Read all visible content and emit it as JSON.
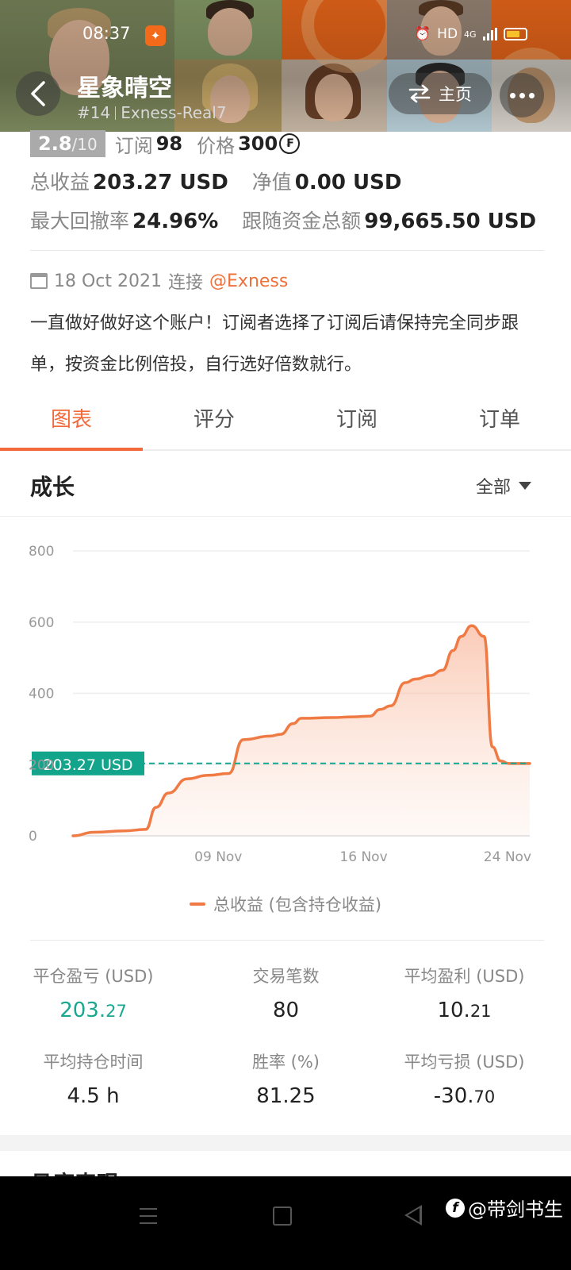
{
  "status_bar": {
    "time": "08:37",
    "indicators": "HD",
    "network": "4G"
  },
  "header": {
    "title": "星象晴空",
    "rank": "#14",
    "account": "Exness-Real7",
    "home_label": "主页"
  },
  "profile": {
    "rating": "2.8",
    "rating_max": "/10",
    "subscriptions_label": "订阅",
    "subscriptions": "98",
    "price_label": "价格",
    "price": "300",
    "price_icon": "₣",
    "total_profit_label": "总收益",
    "total_profit": "203.27 USD",
    "equity_label": "净值",
    "equity": "0.00 USD",
    "max_drawdown_label": "最大回撤率",
    "max_drawdown": "24.96%",
    "follow_funds_label": "跟随资金总额",
    "follow_funds": "99,665.50 USD",
    "connected_date": "18 Oct 2021",
    "connected_label": "连接",
    "broker": "@Exness",
    "description": "一直做好做好这个账户！订阅者选择了订阅后请保持完全同步跟单，按资金比例倍投，自行选好倍数就行。"
  },
  "tabs": [
    {
      "label": "图表",
      "active": true
    },
    {
      "label": "评分",
      "active": false
    },
    {
      "label": "订阅",
      "active": false
    },
    {
      "label": "订单",
      "active": false
    }
  ],
  "section": {
    "title": "成长",
    "filter": "全部"
  },
  "chart_data": {
    "type": "area",
    "y_ticks": [
      "800",
      "600",
      "400",
      "200",
      "0"
    ],
    "ylim": [
      0,
      800
    ],
    "x_ticks": [
      {
        "label": "09 Nov",
        "x": 9
      },
      {
        "label": "16 Nov",
        "x": 16
      },
      {
        "label": "24 Nov",
        "x": 24
      }
    ],
    "xlim": [
      2,
      24
    ],
    "series": [
      {
        "name": "总收益 (包含持仓收益)",
        "color": "#f07a44",
        "x": [
          2,
          3,
          4.5,
          5.5,
          6,
          6.6,
          7.5,
          8.5,
          9.5,
          10.2,
          11.5,
          12,
          12.6,
          13,
          14.5,
          15.5,
          16.3,
          16.8,
          17.3,
          18,
          18.5,
          19.2,
          19.8,
          20.3,
          20.7,
          21.2,
          21.8,
          22.2,
          22.6,
          23,
          24
        ],
        "values": [
          0,
          10,
          14,
          18,
          80,
          120,
          160,
          170,
          175,
          270,
          280,
          285,
          315,
          330,
          332,
          334,
          336,
          355,
          365,
          430,
          440,
          450,
          465,
          520,
          560,
          590,
          560,
          250,
          210,
          203,
          203
        ]
      }
    ],
    "reference_value": 203.27,
    "reference_label": "203.27 USD",
    "grid": true,
    "legend_position": "bottom"
  },
  "legend": {
    "label": "总收益 (包含持仓收益)"
  },
  "metrics": [
    {
      "label": "平仓盈亏 (USD)",
      "main": "203.",
      "fraction": "27",
      "green": true
    },
    {
      "label": "交易笔数",
      "main": "80",
      "fraction": "",
      "green": false
    },
    {
      "label": "平均盈利 (USD)",
      "main": "10.",
      "fraction": "21",
      "green": false
    },
    {
      "label": "平均持仓时间",
      "main": "4.5 h",
      "fraction": "",
      "green": false
    },
    {
      "label": "胜率 (%)",
      "main": "81.25",
      "fraction": "",
      "green": false
    },
    {
      "label": "平均亏损 (USD)",
      "main": "-30.",
      "fraction": "70",
      "green": false
    }
  ],
  "next_section": {
    "title": "月度表现"
  },
  "watermark": {
    "logo": "f",
    "text": "@带剑书生"
  }
}
